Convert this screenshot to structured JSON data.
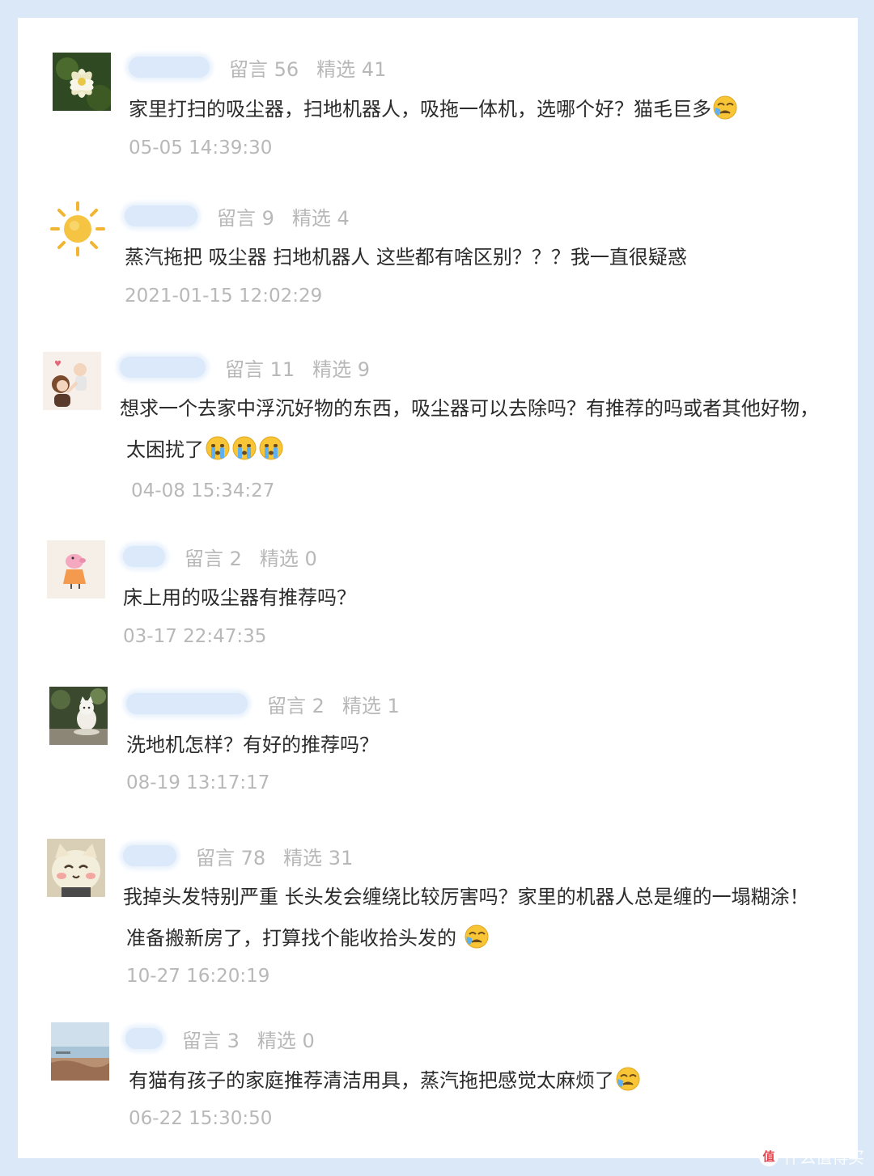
{
  "comments": [
    {
      "avatar": "lotus-flower-avatar",
      "stats": {
        "comments": "留言 56",
        "featured": "精选 41"
      },
      "message": "家里打扫的吸尘器，扫地机器人，吸拖一体机，选哪个好？猫毛巨多",
      "emoji": "crying-emoji",
      "time": "05-05 14:39:30"
    },
    {
      "avatar": "sun-avatar",
      "stats": {
        "comments": "留言 9",
        "featured": "精选 4"
      },
      "message": "蒸汽拖把 吸尘器 扫地机器人 这些都有啥区别？？？我一直很疑惑",
      "time": "2021-01-15 12:02:29"
    },
    {
      "avatar": "mother-baby-avatar",
      "stats": {
        "comments": "留言 11",
        "featured": "精选 9"
      },
      "message": "想求一个去家中浮沉好物的东西，吸尘器可以去除吗？有推荐的吗或者其他好物，",
      "message_line2": "太困扰了",
      "emoji": "sobbing-emoji",
      "time": "04-08 15:34:27"
    },
    {
      "avatar": "pig-cartoon-avatar",
      "stats": {
        "comments": "留言 2",
        "featured": "精选 0"
      },
      "message": "床上用的吸尘器有推荐吗？",
      "time": "03-17 22:47:35"
    },
    {
      "avatar": "cat-statue-avatar",
      "stats": {
        "comments": "留言 2",
        "featured": "精选 1"
      },
      "message": "洗地机怎样？有好的推荐吗？",
      "time": "08-19 13:17:17"
    },
    {
      "avatar": "cat-face-avatar",
      "stats": {
        "comments": "留言 78",
        "featured": "精选 31"
      },
      "message": "我掉头发特别严重 长头发会缠绕比较厉害吗？家里的机器人总是缠的一塌糊涂！",
      "message_line2": "准备搬新房了，打算找个能收拾头发的",
      "emoji": "crying-emoji",
      "time": "10-27 16:20:19"
    },
    {
      "avatar": "seaside-avatar",
      "stats": {
        "comments": "留言 3",
        "featured": "精选 0"
      },
      "message": "有猫有孩子的家庭推荐清洁用具，蒸汽拖把感觉太麻烦了",
      "emoji": "crying-emoji",
      "time": "06-22 15:30:50"
    }
  ],
  "watermark": "什么值得买",
  "colors": {
    "background": "#dbe8f7",
    "card": "#ffffff",
    "meta_text": "#b8b8b8",
    "message_text": "#2b2b2b",
    "name_blur": "#dce9fa"
  }
}
